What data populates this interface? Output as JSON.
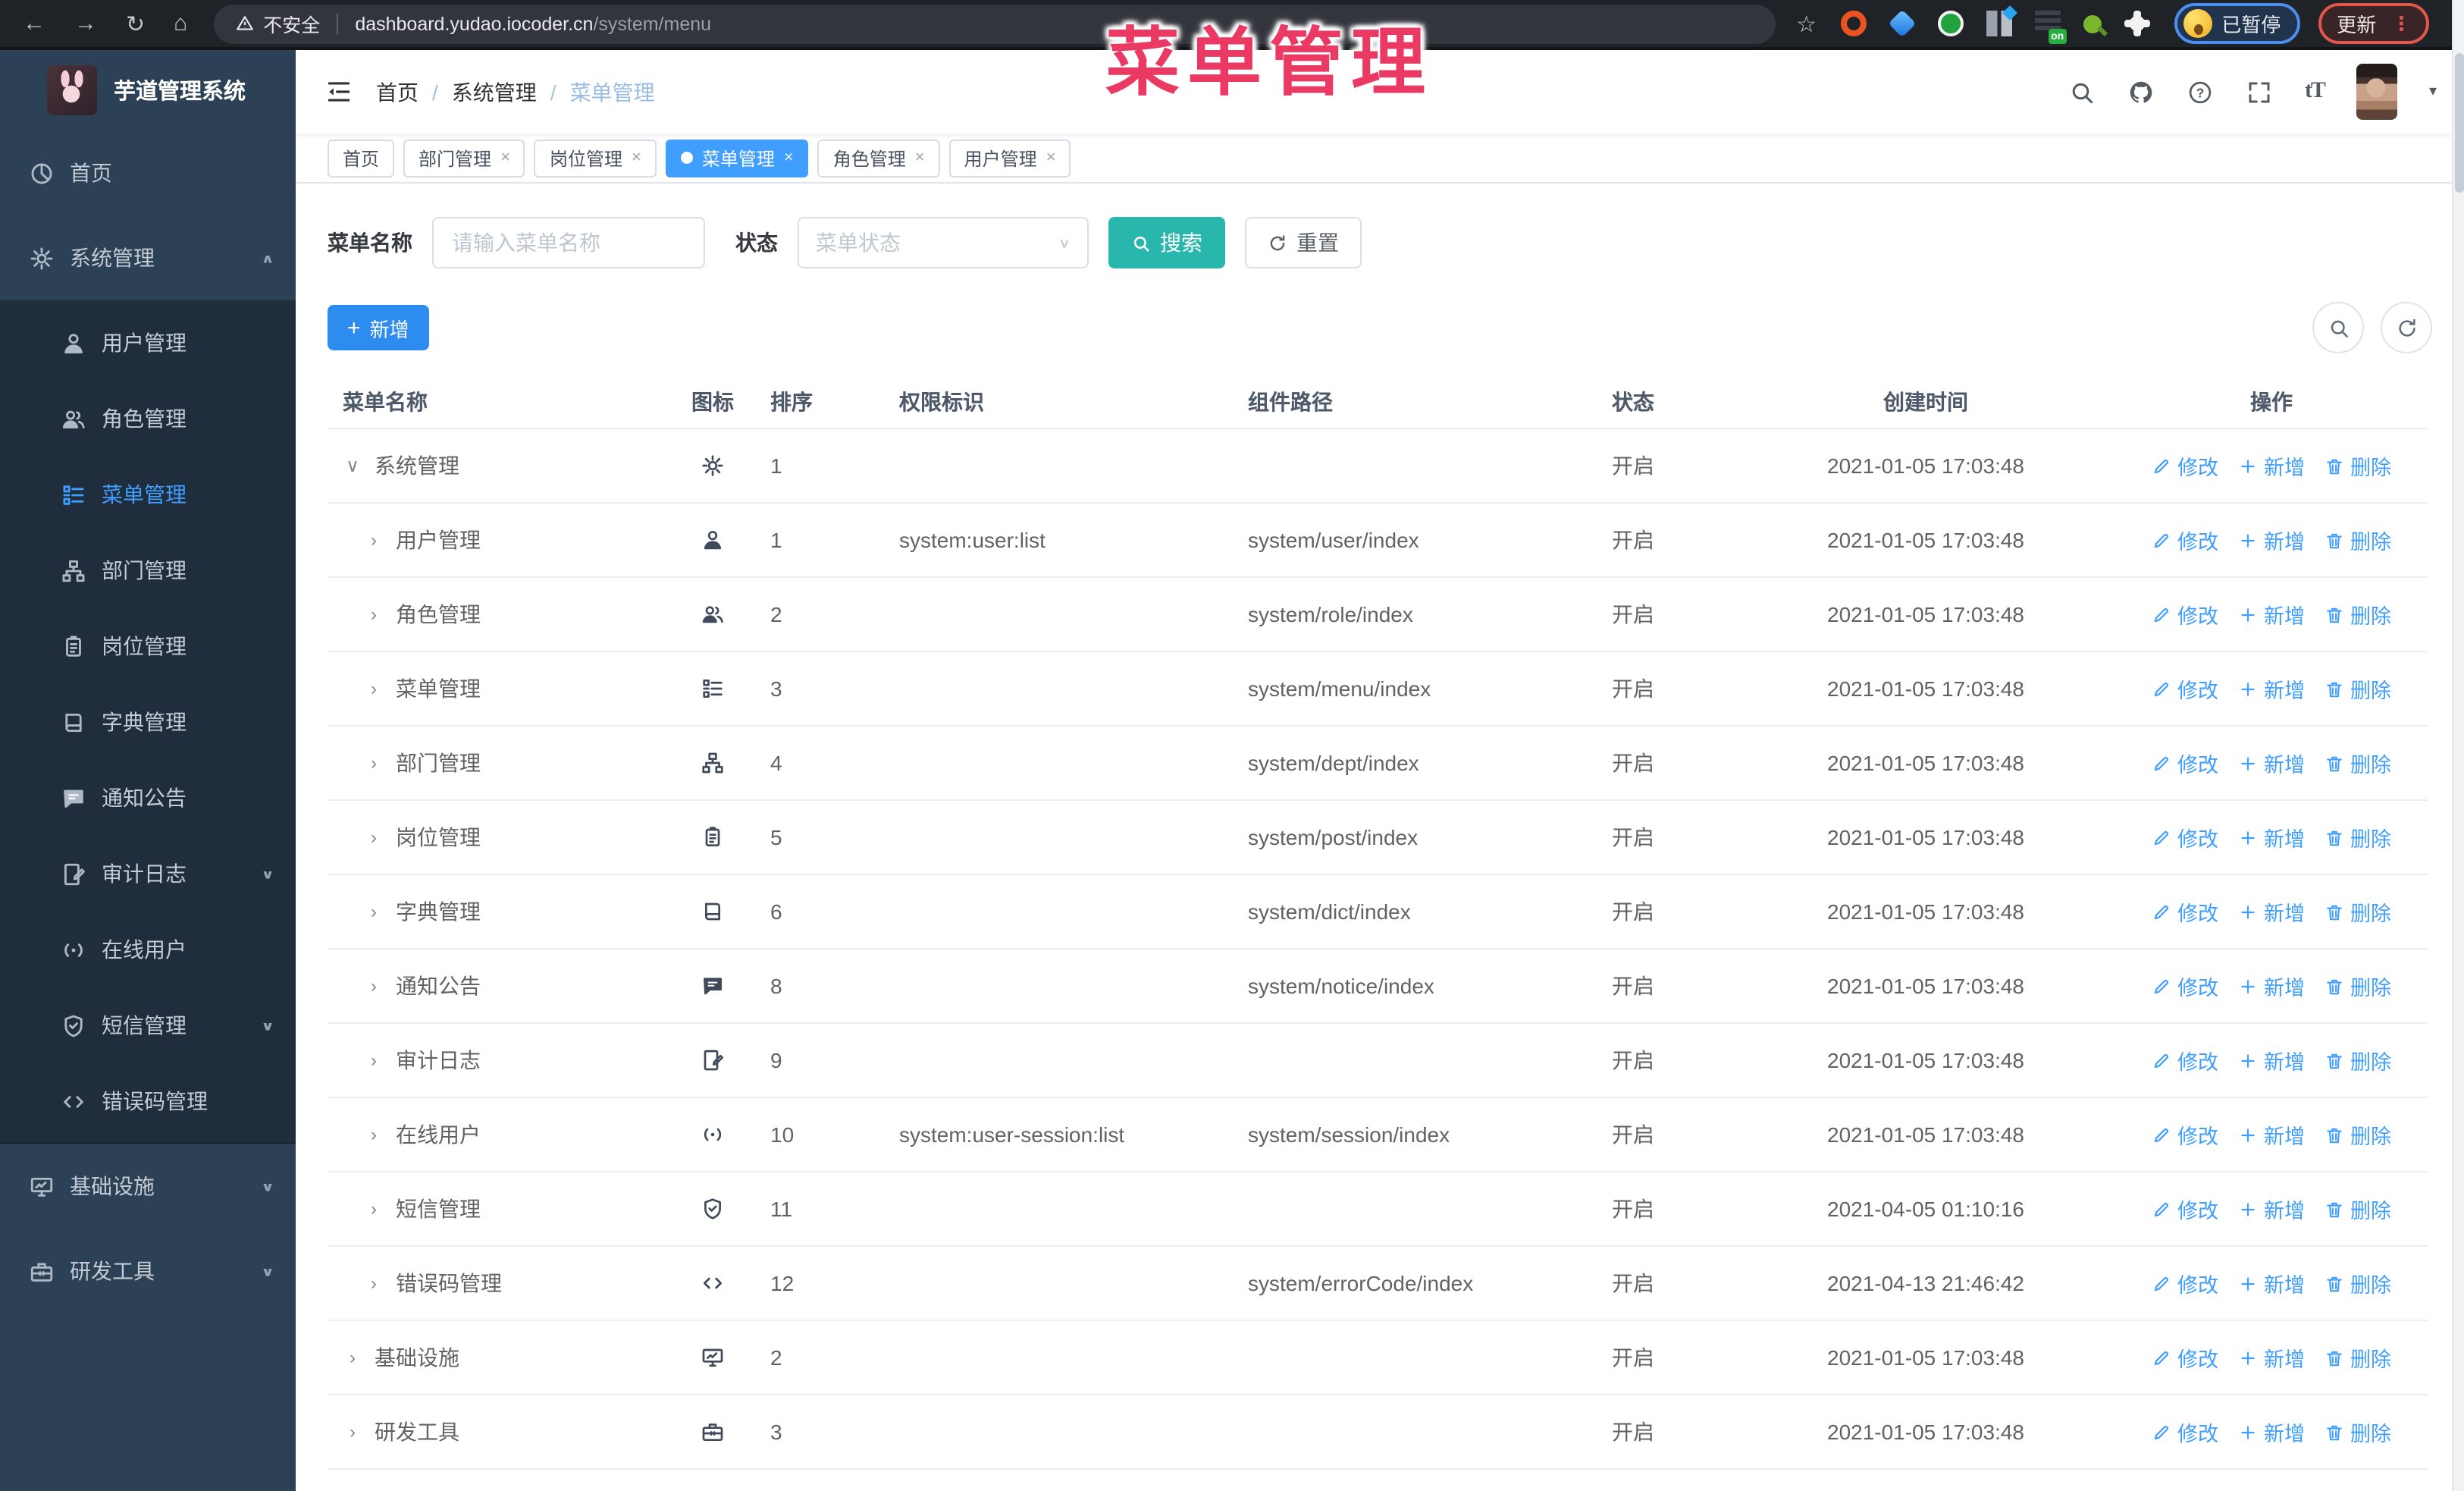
{
  "overlay": {
    "title": "菜单管理",
    "color": "#ea3a64"
  },
  "browser": {
    "security_label": "不安全",
    "url_host": "dashboard.yudao.iocoder.cn",
    "url_path": "/system/menu",
    "paused_badge": "已暂停",
    "update_button": "更新",
    "nav_icons": [
      "back-icon",
      "forward-icon",
      "reload-icon",
      "home-icon"
    ],
    "extensions": [
      "ubuntu",
      "gem",
      "green",
      "grid",
      "list",
      "key",
      "puzzle"
    ]
  },
  "sidebar": {
    "logo_title": "芋道管理系统",
    "items": [
      {
        "label": "首页",
        "icon": "dashboard-icon",
        "type": "top"
      },
      {
        "label": "系统管理",
        "icon": "gear-icon",
        "type": "top",
        "chevron": "up"
      },
      {
        "label": "用户管理",
        "icon": "user-icon",
        "type": "sub"
      },
      {
        "label": "角色管理",
        "icon": "users-icon",
        "type": "sub"
      },
      {
        "label": "菜单管理",
        "icon": "menu-icon",
        "type": "sub",
        "active": true
      },
      {
        "label": "部门管理",
        "icon": "tree-icon",
        "type": "sub"
      },
      {
        "label": "岗位管理",
        "icon": "post-icon",
        "type": "sub"
      },
      {
        "label": "字典管理",
        "icon": "dict-icon",
        "type": "sub"
      },
      {
        "label": "通知公告",
        "icon": "notice-icon",
        "type": "sub"
      },
      {
        "label": "审计日志",
        "icon": "log-icon",
        "type": "sub",
        "chevron": "down"
      },
      {
        "label": "在线用户",
        "icon": "online-icon",
        "type": "sub"
      },
      {
        "label": "短信管理",
        "icon": "sms-icon",
        "type": "sub",
        "chevron": "down"
      },
      {
        "label": "错误码管理",
        "icon": "code-icon",
        "type": "sub"
      },
      {
        "label": "基础设施",
        "icon": "infra-icon",
        "type": "top",
        "chevron": "down"
      },
      {
        "label": "研发工具",
        "icon": "tool-icon",
        "type": "top",
        "chevron": "down"
      }
    ]
  },
  "navbar": {
    "breadcrumb": [
      "首页",
      "系统管理",
      "菜单管理"
    ],
    "right_icons": [
      "search-icon",
      "github-icon",
      "question-icon",
      "fullscreen-icon",
      "font-size-icon"
    ],
    "font_size_glyph": "tT"
  },
  "tabs": [
    {
      "label": "首页",
      "closable": false,
      "active": false
    },
    {
      "label": "部门管理",
      "closable": true,
      "active": false
    },
    {
      "label": "岗位管理",
      "closable": true,
      "active": false
    },
    {
      "label": "菜单管理",
      "closable": true,
      "active": true
    },
    {
      "label": "角色管理",
      "closable": true,
      "active": false
    },
    {
      "label": "用户管理",
      "closable": true,
      "active": false
    }
  ],
  "filters": {
    "name_label": "菜单名称",
    "name_placeholder": "请输入菜单名称",
    "status_label": "状态",
    "status_placeholder": "菜单状态",
    "search_label": "搜索",
    "reset_label": "重置"
  },
  "toolbar": {
    "add_label": "新增"
  },
  "table": {
    "columns": [
      "菜单名称",
      "图标",
      "排序",
      "权限标识",
      "组件路径",
      "状态",
      "创建时间",
      "操作"
    ],
    "op_labels": [
      "修改",
      "新增",
      "删除"
    ],
    "rows": [
      {
        "name": "系统管理",
        "icon": "gear-icon",
        "level": 0,
        "expanded": true,
        "sort": "1",
        "perms": "",
        "path": "",
        "status": "开启",
        "time": "2021-01-05 17:03:48"
      },
      {
        "name": "用户管理",
        "icon": "user-icon",
        "level": 1,
        "expanded": false,
        "sort": "1",
        "perms": "system:user:list",
        "path": "system/user/index",
        "status": "开启",
        "time": "2021-01-05 17:03:48"
      },
      {
        "name": "角色管理",
        "icon": "users-icon",
        "level": 1,
        "expanded": false,
        "sort": "2",
        "perms": "",
        "path": "system/role/index",
        "status": "开启",
        "time": "2021-01-05 17:03:48"
      },
      {
        "name": "菜单管理",
        "icon": "menu-icon",
        "level": 1,
        "expanded": false,
        "sort": "3",
        "perms": "",
        "path": "system/menu/index",
        "status": "开启",
        "time": "2021-01-05 17:03:48"
      },
      {
        "name": "部门管理",
        "icon": "tree-icon",
        "level": 1,
        "expanded": false,
        "sort": "4",
        "perms": "",
        "path": "system/dept/index",
        "status": "开启",
        "time": "2021-01-05 17:03:48"
      },
      {
        "name": "岗位管理",
        "icon": "post-icon",
        "level": 1,
        "expanded": false,
        "sort": "5",
        "perms": "",
        "path": "system/post/index",
        "status": "开启",
        "time": "2021-01-05 17:03:48"
      },
      {
        "name": "字典管理",
        "icon": "dict-icon",
        "level": 1,
        "expanded": false,
        "sort": "6",
        "perms": "",
        "path": "system/dict/index",
        "status": "开启",
        "time": "2021-01-05 17:03:48"
      },
      {
        "name": "通知公告",
        "icon": "notice-icon",
        "level": 1,
        "expanded": false,
        "sort": "8",
        "perms": "",
        "path": "system/notice/index",
        "status": "开启",
        "time": "2021-01-05 17:03:48"
      },
      {
        "name": "审计日志",
        "icon": "log-icon",
        "level": 1,
        "expanded": false,
        "sort": "9",
        "perms": "",
        "path": "",
        "status": "开启",
        "time": "2021-01-05 17:03:48"
      },
      {
        "name": "在线用户",
        "icon": "online-icon",
        "level": 1,
        "expanded": false,
        "sort": "10",
        "perms": "system:user-session:list",
        "path": "system/session/index",
        "status": "开启",
        "time": "2021-01-05 17:03:48"
      },
      {
        "name": "短信管理",
        "icon": "sms-icon",
        "level": 1,
        "expanded": false,
        "sort": "11",
        "perms": "",
        "path": "",
        "status": "开启",
        "time": "2021-04-05 01:10:16"
      },
      {
        "name": "错误码管理",
        "icon": "code-icon",
        "level": 1,
        "expanded": false,
        "sort": "12",
        "perms": "",
        "path": "system/errorCode/index",
        "status": "开启",
        "time": "2021-04-13 21:46:42"
      },
      {
        "name": "基础设施",
        "icon": "infra-icon",
        "level": 0,
        "expanded": false,
        "sort": "2",
        "perms": "",
        "path": "",
        "status": "开启",
        "time": "2021-01-05 17:03:48"
      },
      {
        "name": "研发工具",
        "icon": "tool-icon",
        "level": 0,
        "expanded": false,
        "sort": "3",
        "perms": "",
        "path": "",
        "status": "开启",
        "time": "2021-01-05 17:03:48"
      }
    ]
  },
  "colors": {
    "accent_blue": "#409eff",
    "add_blue": "#2d8cf0",
    "search_teal": "#29b6ac",
    "sidebar_bg": "#2c4156",
    "submenu_bg": "#1f2d3d",
    "annotation_pink": "#ea3a64"
  }
}
